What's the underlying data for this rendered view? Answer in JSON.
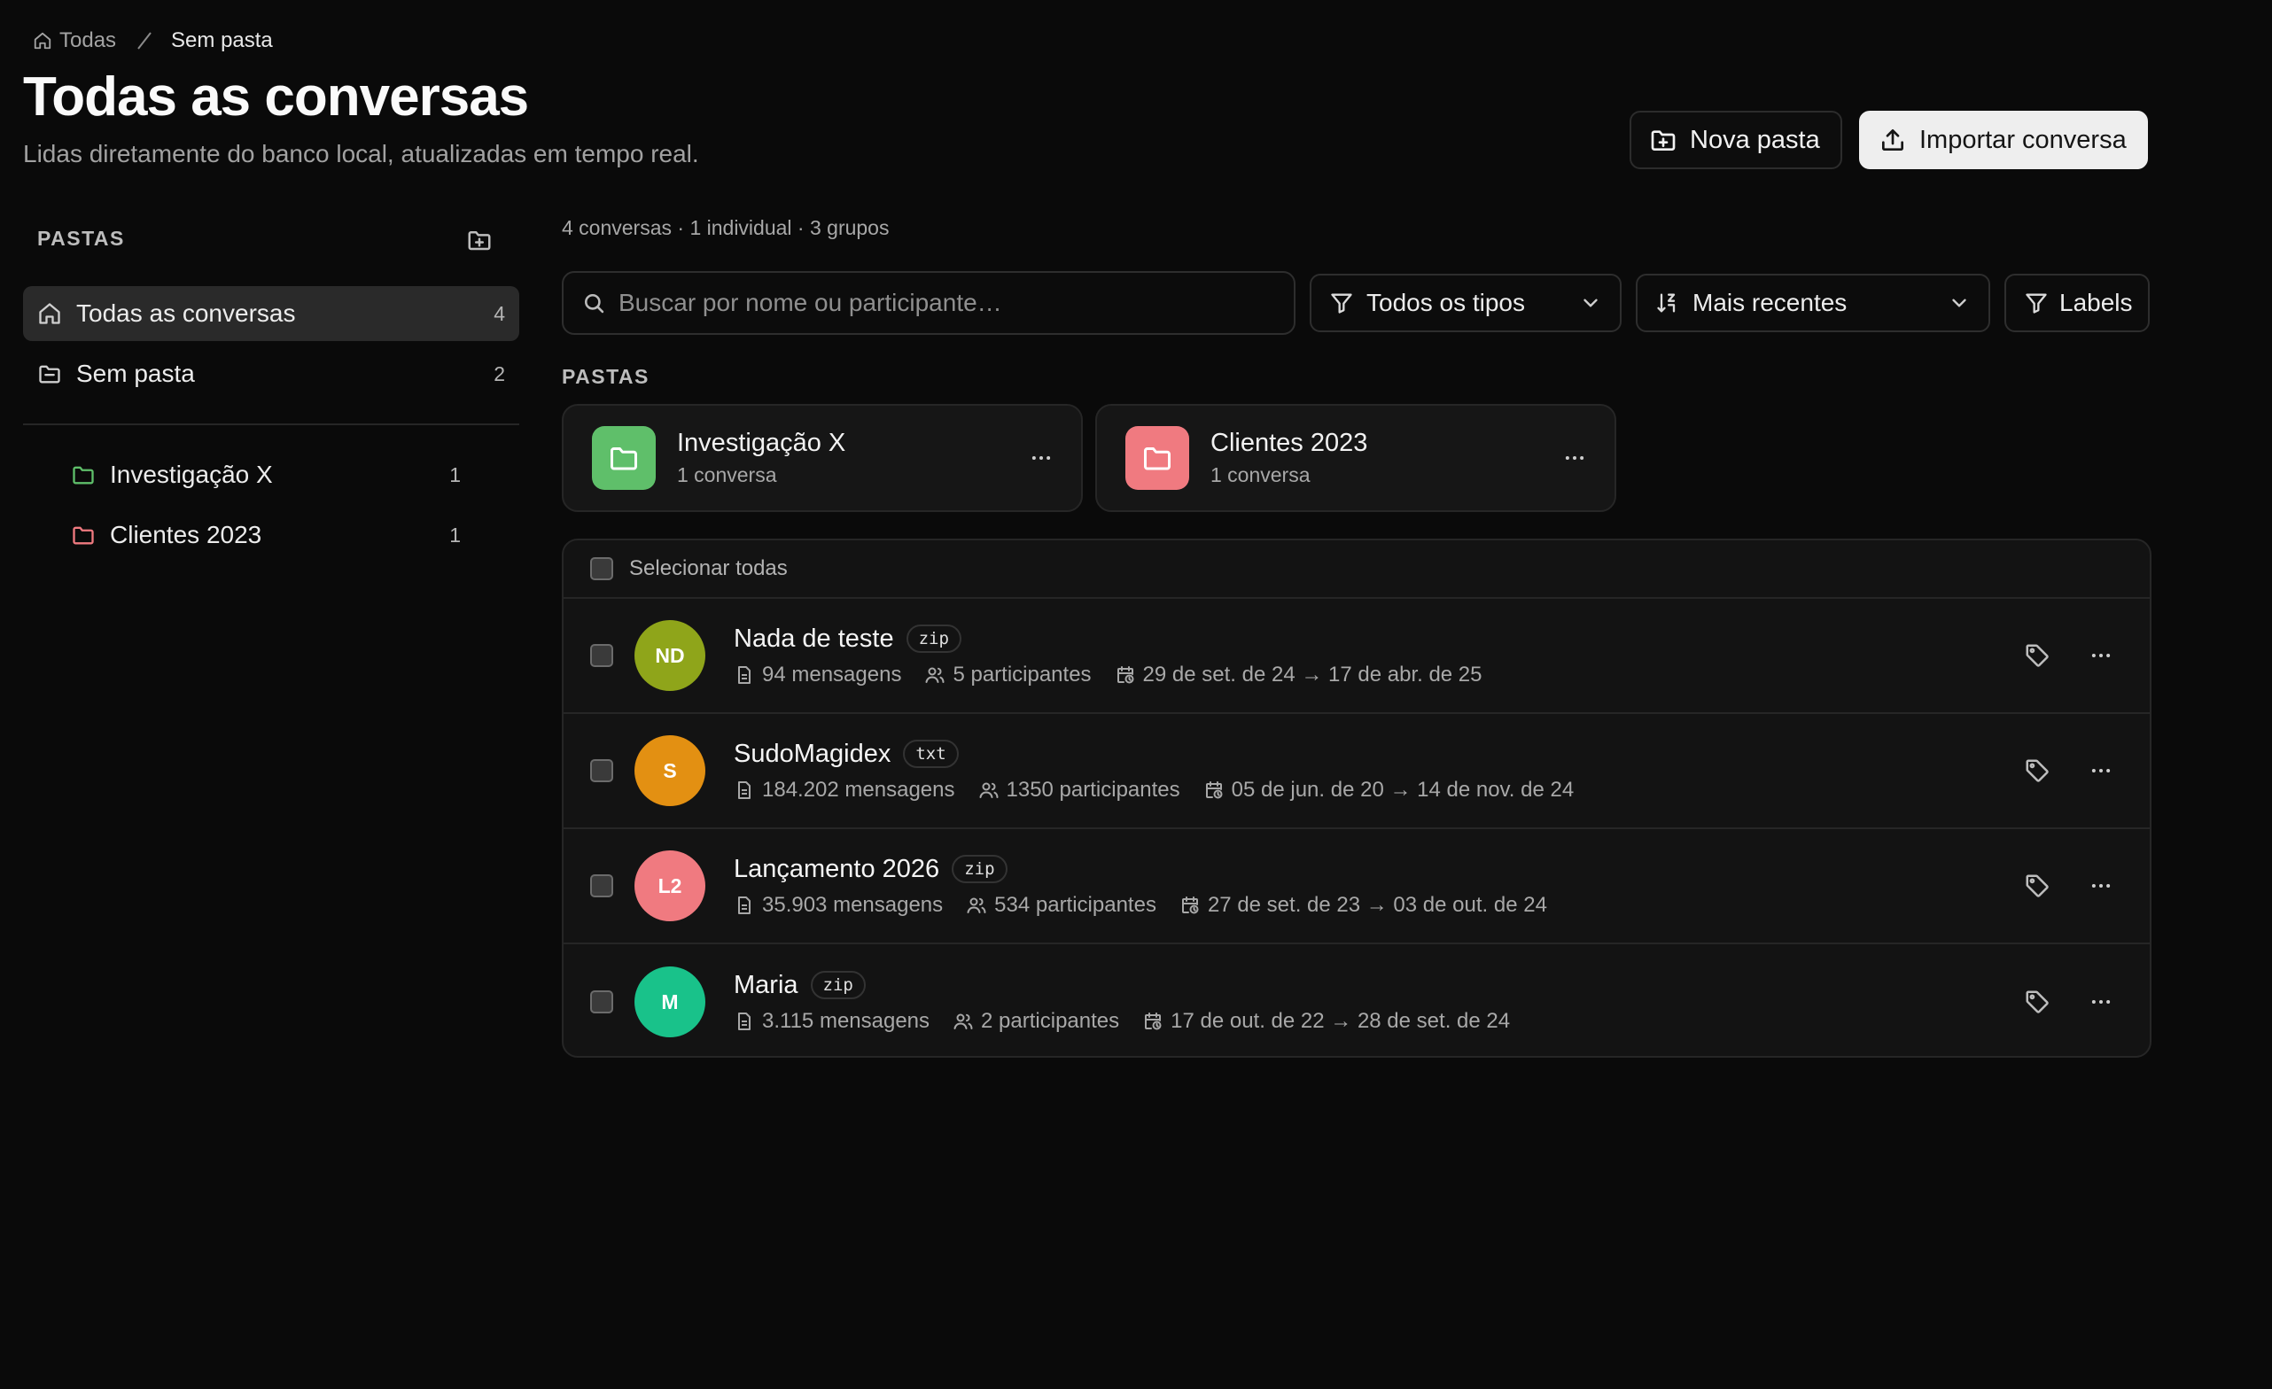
{
  "breadcrumb": {
    "home": "Todas",
    "current": "Sem pasta"
  },
  "header": {
    "title": "Todas as conversas",
    "subtitle": "Lidas diretamente do banco local, atualizadas em tempo real.",
    "new_folder_label": "Nova pasta",
    "import_label": "Importar conversa"
  },
  "sidebar": {
    "heading": "PASTAS",
    "items": [
      {
        "label": "Todas as conversas",
        "count": "4"
      },
      {
        "label": "Sem pasta",
        "count": "2"
      }
    ],
    "folders": [
      {
        "label": "Investigação X",
        "count": "1",
        "color": "#5fbf6a"
      },
      {
        "label": "Clientes 2023",
        "count": "1",
        "color": "#f07a80"
      }
    ]
  },
  "main": {
    "summary": "4 conversas · 1 individual · 3 grupos",
    "search": {
      "placeholder": "Buscar por nome ou participante…"
    },
    "type_filter": "Todos os tipos",
    "sort": "Mais recentes",
    "labels_button": "Labels",
    "folders_heading": "PASTAS",
    "folder_cards": [
      {
        "name": "Investigação X",
        "sub": "1 conversa",
        "color": "#5fbf6a"
      },
      {
        "name": "Clientes 2023",
        "sub": "1 conversa",
        "color": "#f07a80"
      }
    ],
    "select_all": "Selecionar todas",
    "conversations": [
      {
        "initials": "ND",
        "avatar_color": "#8fa51a",
        "name": "Nada de teste",
        "format": "zip",
        "messages": "94 mensagens",
        "participants": "5 participantes",
        "dates": "29 de set. de 24 → 17 de abr. de 25"
      },
      {
        "initials": "S",
        "avatar_color": "#e39012",
        "name": "SudoMagidex",
        "format": "txt",
        "messages": "184.202 mensagens",
        "participants": "1350 participantes",
        "dates": "05 de jun. de 20 → 14 de nov. de 24"
      },
      {
        "initials": "L2",
        "avatar_color": "#f07a80",
        "name": "Lançamento 2026",
        "format": "zip",
        "messages": "35.903 mensagens",
        "participants": "534 participantes",
        "dates": "27 de set. de 23 → 03 de out. de 24"
      },
      {
        "initials": "M",
        "avatar_color": "#19c28a",
        "name": "Maria",
        "format": "zip",
        "messages": "3.115 mensagens",
        "participants": "2 participantes",
        "dates": "17 de out. de 22 → 28 de set. de 24"
      }
    ]
  }
}
